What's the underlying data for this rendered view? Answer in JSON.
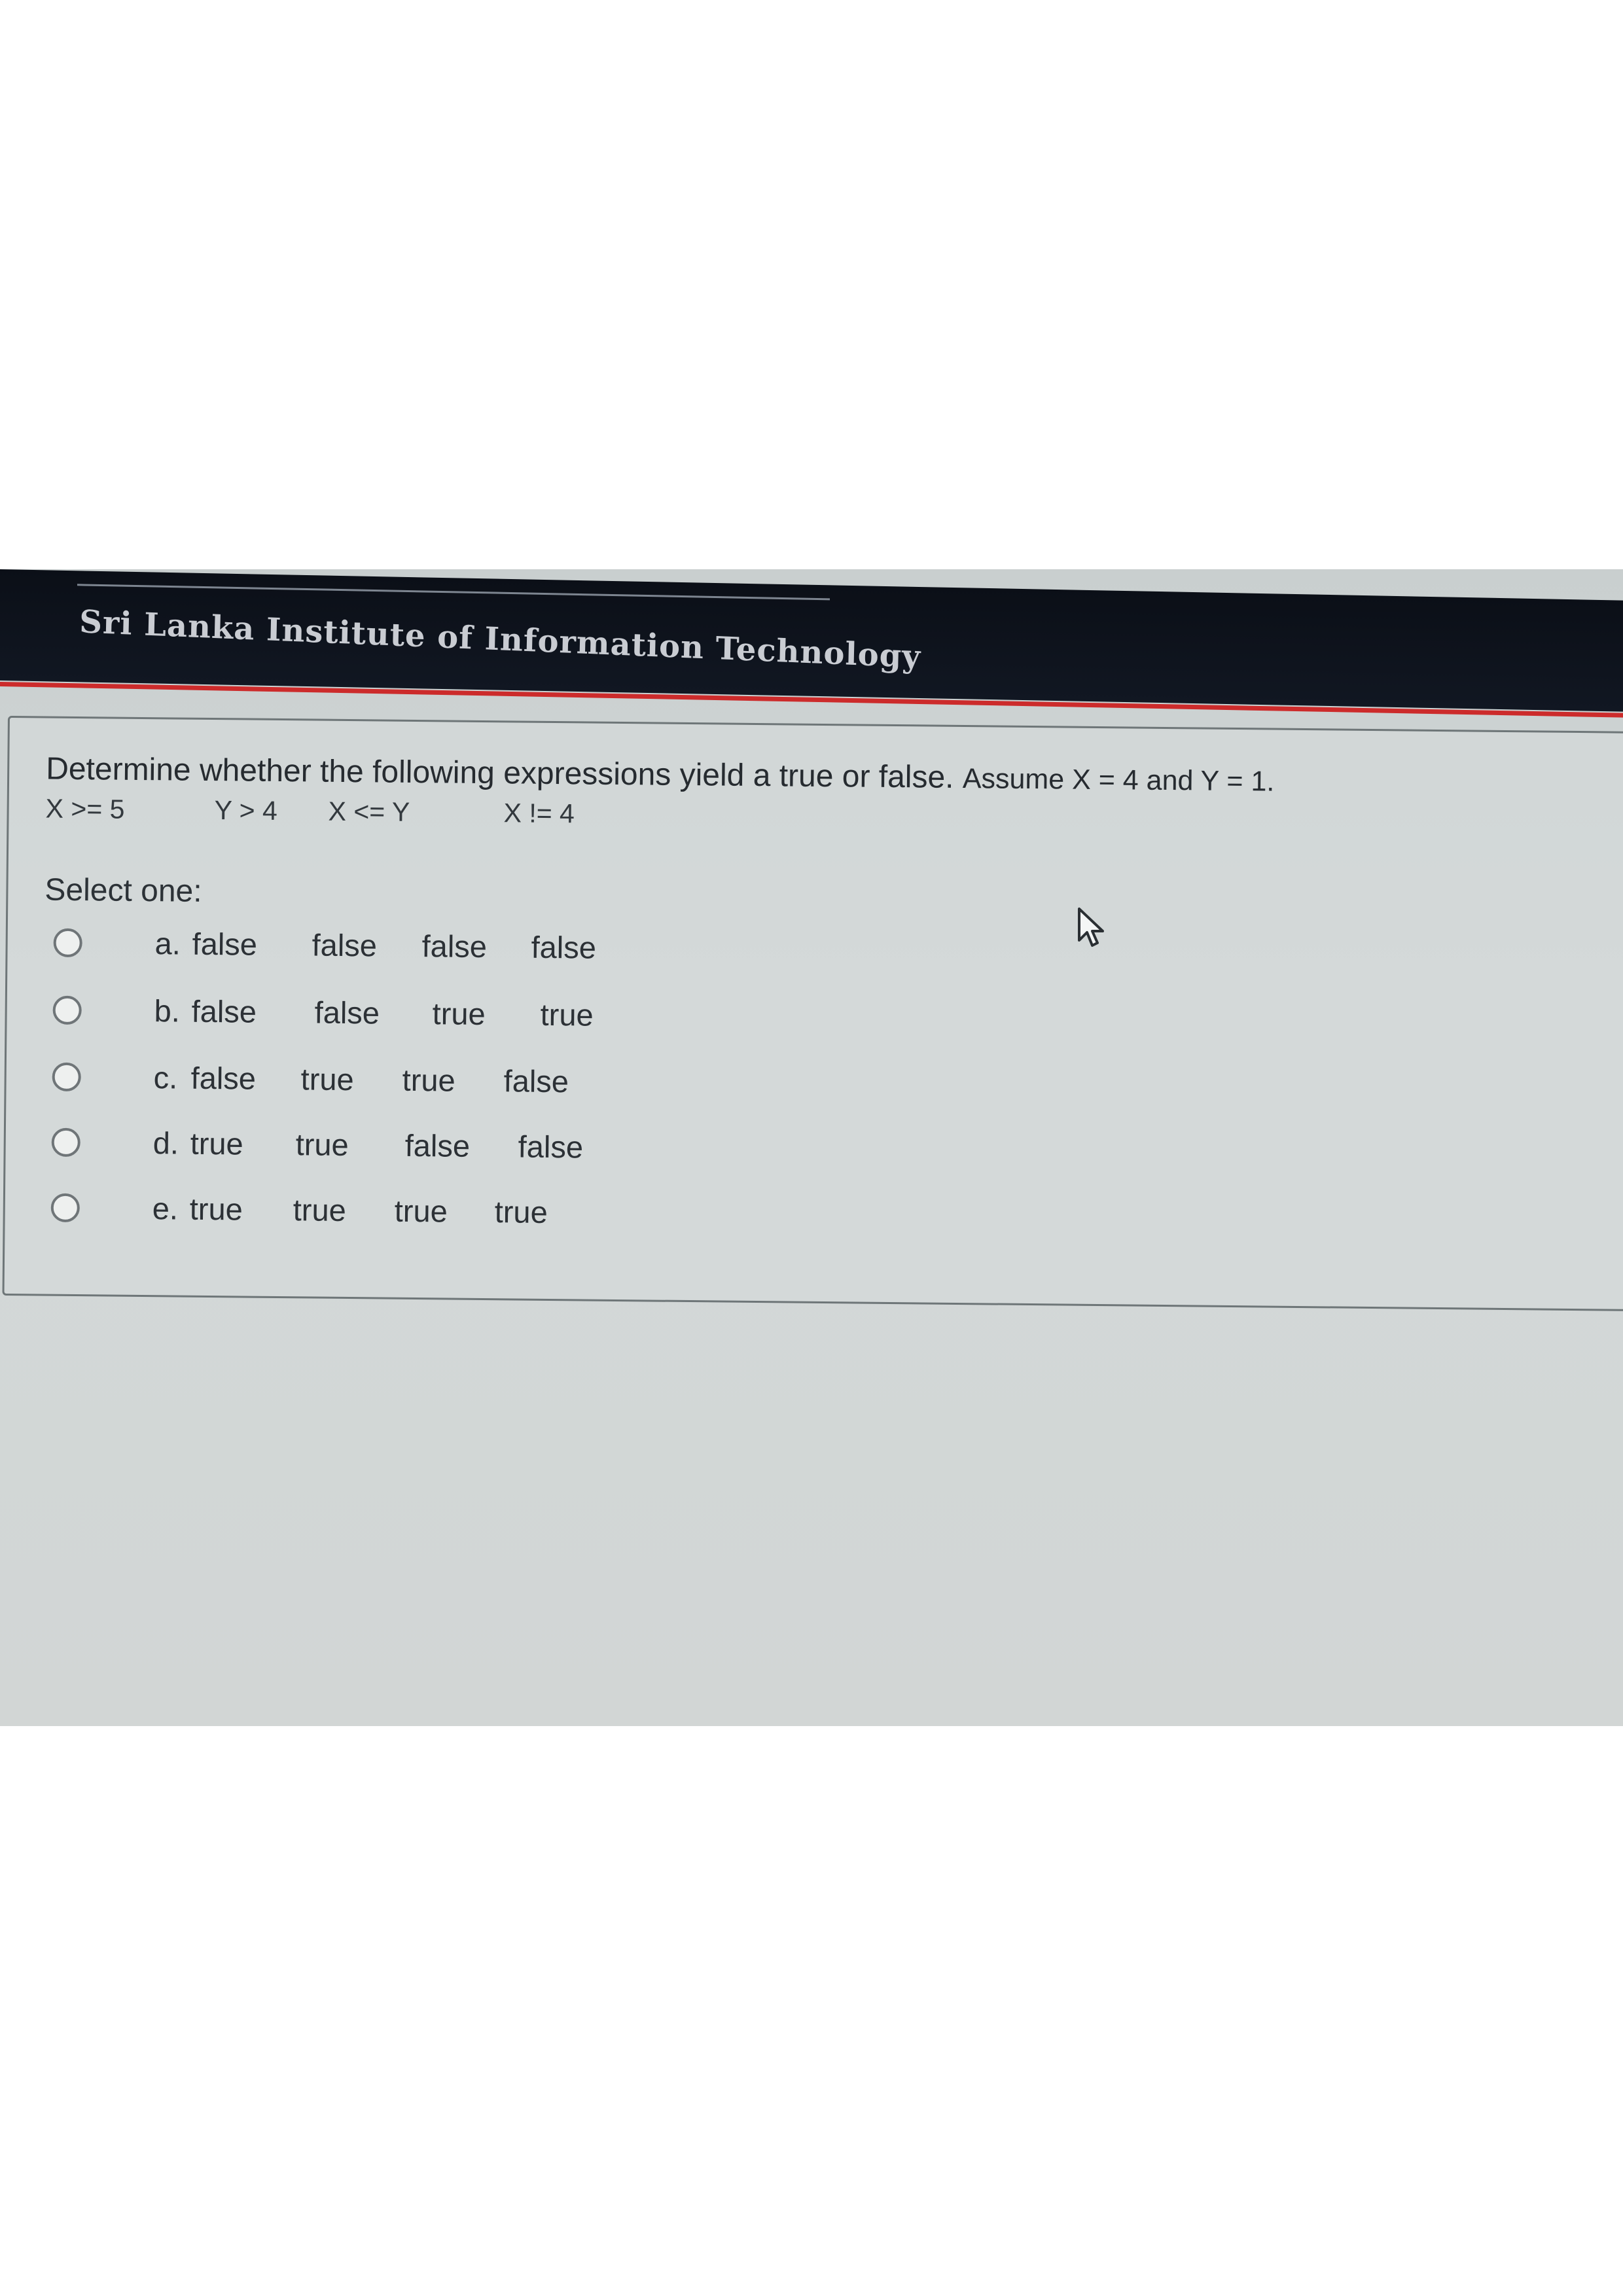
{
  "header": {
    "title": "Sri Lanka Institute of Information Technology"
  },
  "question": {
    "text": "Determine whether the following expressions yield a true or false.",
    "assumption": "Assume X = 4 and Y = 1.",
    "expressions": [
      "X >= 5",
      "Y > 4",
      "X <= Y",
      "X != 4"
    ],
    "select_label": "Select one:",
    "options": [
      {
        "letter": "a.",
        "values": [
          "false",
          "false",
          "false",
          "false"
        ]
      },
      {
        "letter": "b.",
        "values": [
          "false",
          "false",
          "true",
          "true"
        ]
      },
      {
        "letter": "c.",
        "values": [
          "false",
          "true",
          "true",
          "false"
        ]
      },
      {
        "letter": "d.",
        "values": [
          "true",
          "true",
          "false",
          "false"
        ]
      },
      {
        "letter": "e.",
        "values": [
          "true",
          "true",
          "true",
          "true"
        ]
      }
    ]
  },
  "icons": {
    "radio": "radio-button-icon",
    "cursor": "mouse-pointer-icon"
  },
  "colors": {
    "header_bg": "#0b0f17",
    "accent_red": "#cc2b2b",
    "page_bg": "#d2d6d5"
  }
}
